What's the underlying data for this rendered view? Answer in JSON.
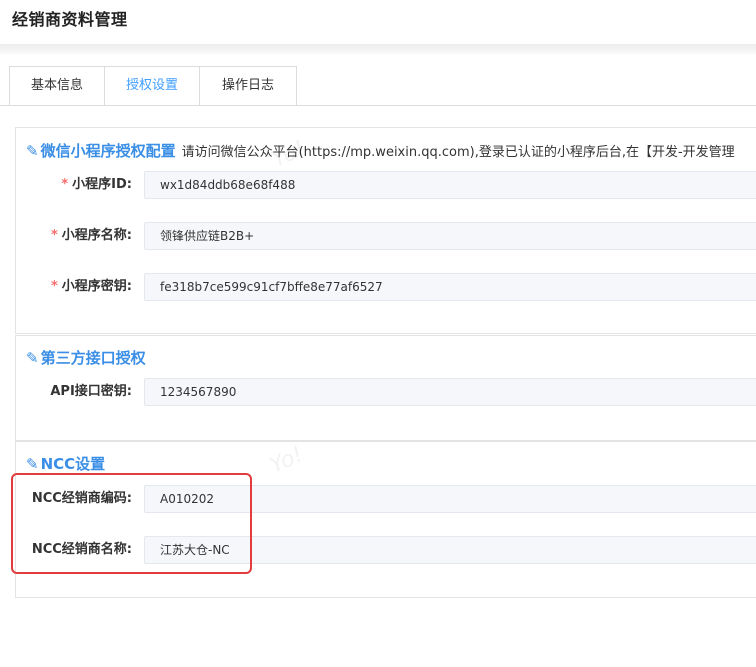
{
  "header": {
    "title": "经销商资料管理"
  },
  "tabs": [
    {
      "label": "基本信息"
    },
    {
      "label": "授权设置"
    },
    {
      "label": "操作日志"
    }
  ],
  "wechat": {
    "title": "微信小程序授权配置",
    "description": "请访问微信公众平台(https://mp.weixin.qq.com),登录已认证的小程序后台,在【开发-开发管理",
    "fields": [
      {
        "label": "小程序ID:",
        "value": "wx1d84ddb68e68f488"
      },
      {
        "label": "小程序名称:",
        "value": "领锋供应链B2B+"
      },
      {
        "label": "小程序密钥:",
        "value": "fe318b7ce599c91cf7bffe8e77af6527"
      }
    ]
  },
  "api": {
    "title": "第三方接口授权",
    "fields": [
      {
        "label": "API接口密钥:",
        "value": "1234567890"
      }
    ]
  },
  "ncc": {
    "title": "NCC设置",
    "fields": [
      {
        "label": "NCC经销商编码:",
        "value": "A010202"
      },
      {
        "label": "NCC经销商名称:",
        "value": "江苏大仓-NC"
      }
    ]
  },
  "watermark": "Yo!",
  "colors": {
    "accent": "#409eff",
    "required": "#f56c6c",
    "highlight": "#e23c3c"
  }
}
